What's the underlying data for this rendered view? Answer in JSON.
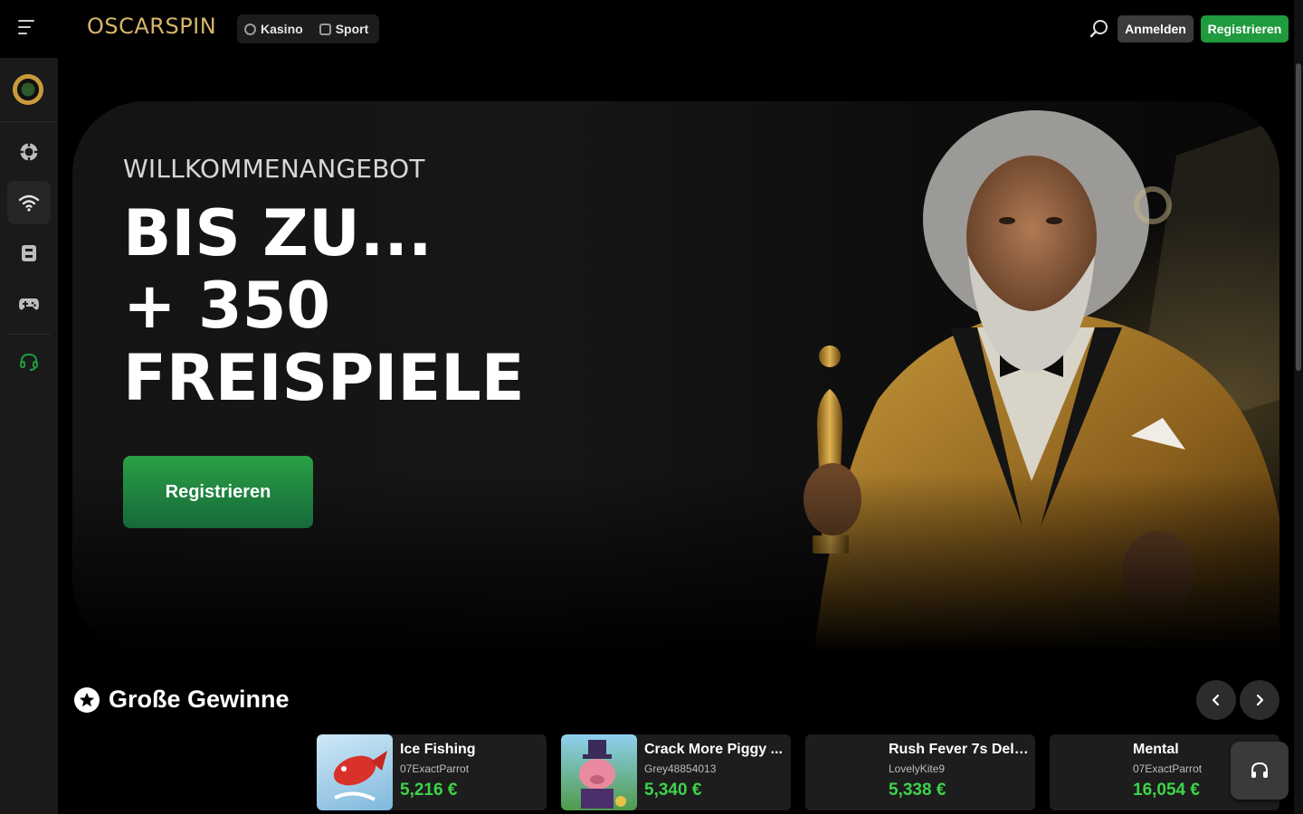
{
  "header": {
    "logo_text": "OSCARSPIN",
    "tabs": [
      {
        "label": "Kasino",
        "icon": "chip-icon"
      },
      {
        "label": "Sport",
        "icon": "sport-icon"
      }
    ],
    "search_icon": "search-icon",
    "login_label": "Anmelden",
    "register_label": "Registrieren",
    "accent_color": "#1f9a3e"
  },
  "sidebar": {
    "items": [
      {
        "icon": "casino-chip-icon",
        "active": false
      },
      {
        "icon": "live-wifi-icon",
        "active": true
      },
      {
        "icon": "sport-ticket-icon",
        "active": false
      },
      {
        "icon": "gamepad-icon",
        "active": false
      },
      {
        "icon": "support-headset-icon",
        "active": false
      }
    ]
  },
  "hero": {
    "kicker": "WILLKOMMENANGEBOT",
    "title_line1": "BIS ZU...",
    "title_line2": "+ 350",
    "title_line3": "FREISPIELE",
    "cta_label": "Registrieren"
  },
  "big_wins": {
    "title": "Große Gewinne",
    "items": [
      {
        "game": "Ice Fishing",
        "user": "07ExactParrot",
        "amount": "5,216 €"
      },
      {
        "game": "Crack More Piggy ...",
        "user": "Grey48854013",
        "amount": "5,340 €"
      },
      {
        "game": "Rush Fever 7s Delu...",
        "user": "LovelyKite9",
        "amount": "5,338 €"
      },
      {
        "game": "Mental",
        "user": "07ExactParrot",
        "amount": "16,054 €"
      }
    ]
  }
}
